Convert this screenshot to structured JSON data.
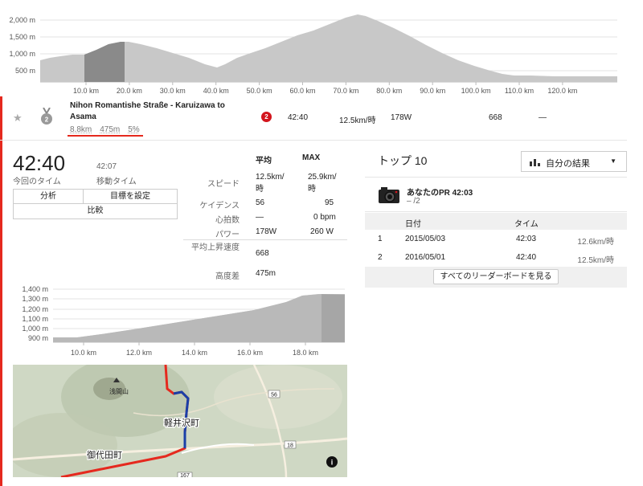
{
  "top_profile": {
    "y_ticks": [
      "2,000 m",
      "1,500 m",
      "1,000 m",
      "500 m"
    ],
    "x_ticks": [
      "10.0 km",
      "20.0 km",
      "30.0 km",
      "40.0 km",
      "50.0 km",
      "60.0 km",
      "70.0 km",
      "80.0 km",
      "90.0 km",
      "100.0 km",
      "110.0 km",
      "120.0 km"
    ]
  },
  "segment": {
    "star": "★",
    "medal_rank": "2",
    "name": "Nihon Romantishe Straße - Karuizawa to Asama",
    "distance": "8.8km",
    "elev_gain": "475m",
    "grade": "5%",
    "rank_badge": "2",
    "time": "42:40",
    "speed": "12.5km/時",
    "power": "178W",
    "hr_or_cal": "668",
    "dash": "—"
  },
  "summary": {
    "elapsed_time": "42:40",
    "elapsed_label": "今回のタイム",
    "moving_time": "42:07",
    "moving_label": "移動タイム",
    "btn_analysis": "分析",
    "btn_set_goal": "目標を設定",
    "btn_compare": "比較"
  },
  "stats": {
    "col_avg": "平均",
    "col_max": "MAX",
    "speed_label": "スピード",
    "speed_avg": "12.5km/時",
    "speed_max": "25.9km/時",
    "cadence_label": "ケイデンス",
    "cadence_avg": "56",
    "cadence_max": "95",
    "hr_label": "心拍数",
    "hr_avg": "—",
    "hr_max": "0 bpm",
    "power_label": "パワー",
    "power_avg": "178W",
    "power_max": "260 W",
    "vam_label": "平均上昇速度",
    "vam_val": "668",
    "elev_label": "高度差",
    "elev_val": "475m"
  },
  "seg_profile": {
    "y_ticks": [
      "1,400 m",
      "1,300 m",
      "1,200 m",
      "1,100 m",
      "1,000 m",
      "900 m"
    ],
    "x_ticks": [
      "10.0 km",
      "12.0 km",
      "14.0 km",
      "16.0 km",
      "18.0 km"
    ]
  },
  "leaderboard": {
    "title": "トップ 10",
    "dropdown_label": "自分の結果",
    "pr_label": "あなたのPR 42:03",
    "pr_sub": "– /2",
    "col_date": "日付",
    "col_time": "タイム",
    "rows": [
      {
        "rank": "1",
        "date": "2015/05/03",
        "time": "42:03",
        "speed": "12.6km/時"
      },
      {
        "rank": "2",
        "date": "2016/05/01",
        "time": "42:40",
        "speed": "12.5km/時"
      }
    ],
    "view_all": "すべてのリーダーボードを見る"
  },
  "map": {
    "labels": {
      "asama": "浅間山",
      "karuizawa": "軽井沢町",
      "miyota": "御代田町",
      "route_56": "56",
      "route_18": "18",
      "route_167": "167"
    },
    "colors": {
      "route_red": "#e5291e",
      "route_blue": "#1a3fa8",
      "terrain": "#cfd8c4",
      "road": "#f6efe0"
    }
  },
  "colors": {
    "accent": "#e5291e",
    "profile_fill": "#c8c8c8",
    "profile_highlight": "#8a8a8a"
  }
}
